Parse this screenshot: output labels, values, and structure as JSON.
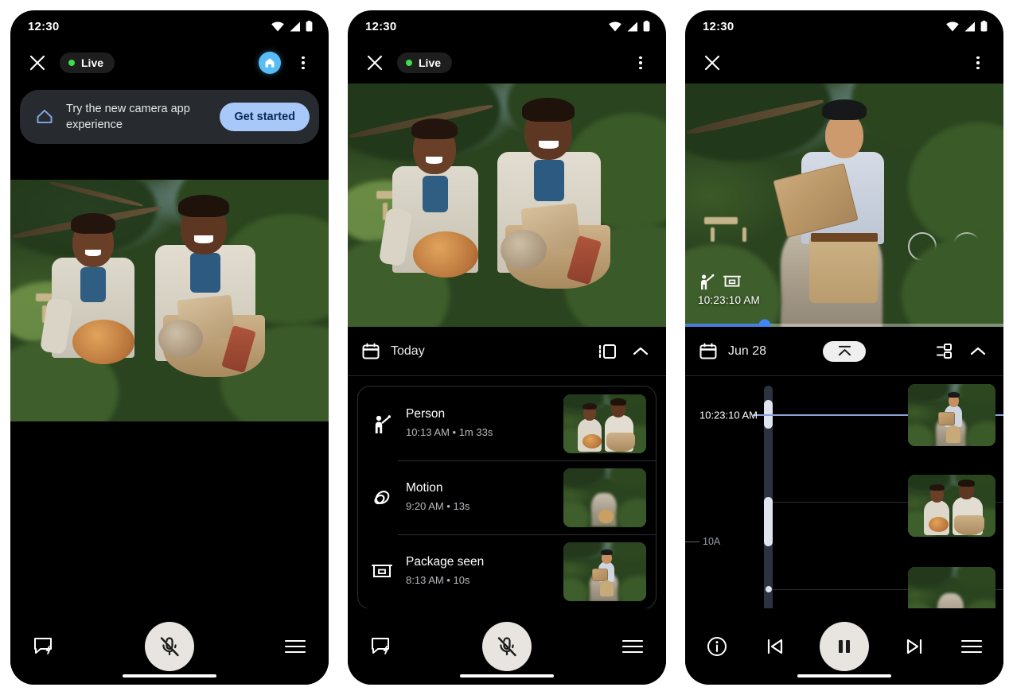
{
  "panels": [
    {
      "id": "live-view-with-promo",
      "status": {
        "time": "12:30",
        "icons": [
          "wifi-icon",
          "signal-icon",
          "battery-icon"
        ]
      },
      "appbar": {
        "close_label": "Close",
        "live_label": "Live",
        "home_badge": "home-icon",
        "overflow_label": "More options"
      },
      "promo": {
        "icon": "nest-home-icon",
        "text": "Try the new camera app experience",
        "button_label": "Get started"
      },
      "bottom": {
        "talk_icon": "talk-back-icon",
        "mic_label": "Microphone muted",
        "menu_icon": "menu-icon"
      }
    },
    {
      "id": "live-view-with-events",
      "status": {
        "time": "12:30",
        "icons": [
          "wifi-icon",
          "signal-icon",
          "battery-icon"
        ]
      },
      "appbar": {
        "close_label": "Close",
        "live_label": "Live",
        "overflow_label": "More options"
      },
      "sheet": {
        "calendar_icon": "calendar-icon",
        "title": "Today",
        "layout_icon": "timeline-view-icon",
        "collapse_icon": "chevron-up-icon"
      },
      "events": [
        {
          "icon": "person-icon",
          "title": "Person",
          "time": "10:13 AM",
          "duration": "1m 33s",
          "subtitle": "10:13 AM • 1m 33s",
          "thumb": "two-men-with-pie"
        },
        {
          "icon": "motion-icon",
          "title": "Motion",
          "time": "9:20 AM",
          "duration": "13s",
          "subtitle": "9:20 AM • 13s",
          "thumb": "garden-path-with-dog"
        },
        {
          "icon": "package-icon",
          "title": "Package seen",
          "time": "8:13 AM",
          "duration": "10s",
          "subtitle": "8:13 AM • 10s",
          "thumb": "delivery-person"
        }
      ],
      "bottom": {
        "talk_icon": "talk-back-icon",
        "mic_label": "Microphone muted",
        "menu_icon": "menu-icon"
      }
    },
    {
      "id": "history-playback",
      "status": {
        "time": "12:30",
        "icons": [
          "wifi-icon",
          "signal-icon",
          "battery-icon"
        ]
      },
      "appbar": {
        "close_label": "Close",
        "overflow_label": "More options"
      },
      "video_overlay": {
        "chips": [
          "person-icon",
          "package-icon"
        ],
        "timestamp": "10:23:10 AM",
        "scrub_percent": 25
      },
      "sheet": {
        "calendar_icon": "calendar-icon",
        "title": "Jun 28",
        "jump_icon": "jump-to-top-icon",
        "filter_icon": "filter-icon",
        "collapse_icon": "chevron-up-icon"
      },
      "timeline": {
        "playhead_label": "10:23:10 AM",
        "hour_label": "10A",
        "thumbs": [
          "delivery-person",
          "two-men-with-pie",
          "garden-path"
        ]
      },
      "bottom": {
        "info_icon": "info-icon",
        "prev_icon": "skip-previous-icon",
        "play_label": "Pause",
        "next_icon": "skip-next-icon",
        "menu_icon": "menu-icon"
      }
    }
  ],
  "colors": {
    "accent_blue": "#a8c8fa",
    "live_green": "#3ddc4a",
    "home_badge": "#58bdf6",
    "scrub_blue": "#4285f4",
    "panel_bg": "#000000",
    "card_bg": "#272a2e"
  }
}
